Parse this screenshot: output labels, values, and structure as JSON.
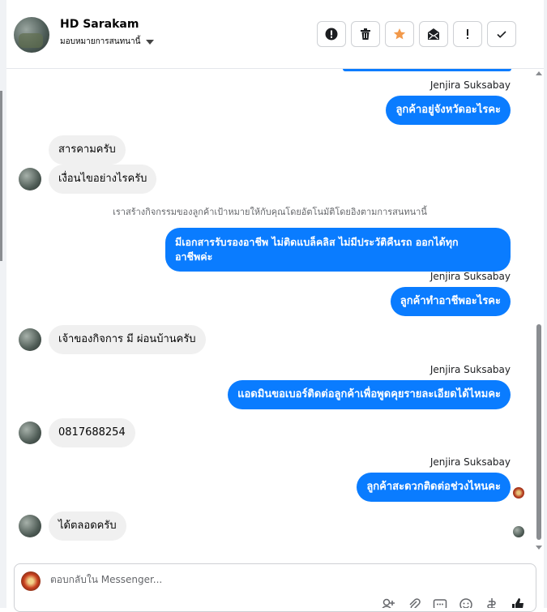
{
  "header": {
    "name": "HD Sarakam",
    "assign_label": "มอบหมายการสนทนานี้",
    "actions": [
      "exclamation-circle",
      "trash",
      "star",
      "mail",
      "mark",
      "check"
    ]
  },
  "colors": {
    "accent": "#0a7cff",
    "star": "#f2994a",
    "incoming_bg": "#f0f0f0"
  },
  "messages": [
    {
      "sender": "Jenjira Suksabay",
      "text": "ลูกค้าอยู่จังหวัดอะไรคะ"
    },
    {
      "text": "สารคามครับ"
    },
    {
      "text": "เงื่อนไขอย่างไรครับ"
    },
    {
      "system": "เราสร้างกิจกรรมของลูกค้าเป้าหมายให้กับคุณโดยอัตโนมัติโดยอิงตามการสนทนานี้"
    },
    {
      "text_line1": "มีเอกสารรับรองอาชีพ ไม่ติดแบล็คลิส ไม่มีประวัติคืนรถ ออกได้ทุก",
      "text_line2": "อาชีพค่ะ"
    },
    {
      "sender": "Jenjira Suksabay",
      "text": "ลูกค้าทำอาชีพอะไรคะ"
    },
    {
      "text": "เจ้าของกิจการ มี ผ่อนบ้านครับ"
    },
    {
      "sender": "Jenjira Suksabay",
      "text": "แอดมินขอเบอร์ติดต่อลูกค้าเพื่อพูดคุยรายละเอียดได้ไหมคะ"
    },
    {
      "text": "0817688254"
    },
    {
      "sender": "Jenjira Suksabay",
      "text": "ลูกค้าสะดวกติดต่อช่วงไหนคะ"
    },
    {
      "text": "ได้ตลอดครับ"
    }
  ],
  "composer": {
    "placeholder": "ตอบกลับใน Messenger..."
  }
}
